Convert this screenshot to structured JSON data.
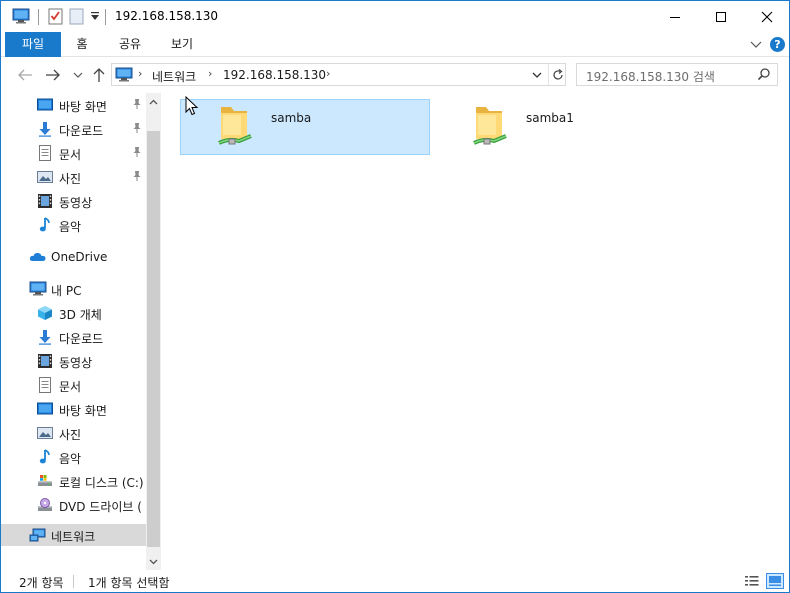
{
  "window": {
    "title": "192.168.158.130"
  },
  "ribbon": {
    "tabs": [
      {
        "label": "파일",
        "active": true
      },
      {
        "label": "홈"
      },
      {
        "label": "공유"
      },
      {
        "label": "보기"
      }
    ],
    "help_label": "?"
  },
  "address": {
    "crumbs": [
      "네트워크",
      "192.168.158.130"
    ]
  },
  "search": {
    "placeholder": "192.168.158.130 검색"
  },
  "navpane": {
    "quick_access": [
      {
        "label": "바탕 화면",
        "icon": "desktop-icon",
        "pinned": true
      },
      {
        "label": "다운로드",
        "icon": "download-icon",
        "pinned": true
      },
      {
        "label": "문서",
        "icon": "document-icon",
        "pinned": true
      },
      {
        "label": "사진",
        "icon": "pictures-icon",
        "pinned": true
      },
      {
        "label": "동영상",
        "icon": "video-icon",
        "pinned": false
      },
      {
        "label": "음악",
        "icon": "music-icon",
        "pinned": false
      }
    ],
    "onedrive": {
      "label": "OneDrive",
      "icon": "onedrive-icon"
    },
    "this_pc": {
      "label": "내 PC",
      "icon": "computer-icon"
    },
    "pc_items": [
      {
        "label": "3D 개체",
        "icon": "3d-objects-icon"
      },
      {
        "label": "다운로드",
        "icon": "download-icon"
      },
      {
        "label": "동영상",
        "icon": "video-icon"
      },
      {
        "label": "문서",
        "icon": "document-icon"
      },
      {
        "label": "바탕 화면",
        "icon": "desktop-icon"
      },
      {
        "label": "사진",
        "icon": "pictures-icon"
      },
      {
        "label": "음악",
        "icon": "music-icon"
      },
      {
        "label": "로컬 디스크 (C:)",
        "icon": "local-disk-icon"
      },
      {
        "label": "DVD 드라이브 (",
        "icon": "dvd-drive-icon"
      }
    ],
    "network": {
      "label": "네트워크",
      "icon": "network-icon",
      "selected": true
    }
  },
  "content": {
    "items": [
      {
        "name": "samba",
        "icon": "shared-folder-icon",
        "selected": true
      },
      {
        "name": "samba1",
        "icon": "shared-folder-icon",
        "selected": false
      }
    ]
  },
  "status": {
    "count": "2개 항목",
    "selection": "1개 항목 선택함"
  },
  "colors": {
    "accent": "#1979ca",
    "selection": "#cce8ff",
    "selection_border": "#99d1ff",
    "nav_selected": "#d9d9d9"
  }
}
